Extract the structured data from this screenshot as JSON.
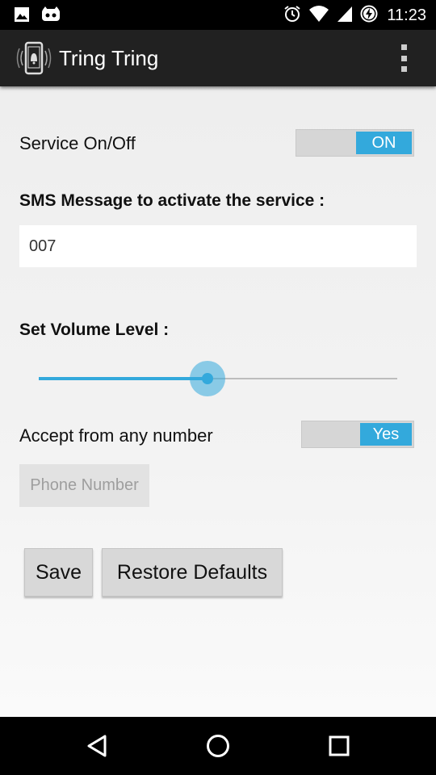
{
  "status_bar": {
    "time": "11:23",
    "left_icons": [
      "image-icon",
      "cyanogen-icon"
    ],
    "right_icons": [
      "alarm-icon",
      "wifi-icon",
      "signal-icon",
      "battery-charging-icon"
    ]
  },
  "action_bar": {
    "title": "Tring Tring",
    "app_icon": "phone-ringing-icon",
    "menu_icon": "overflow-menu-icon"
  },
  "settings": {
    "service_label": "Service On/Off",
    "service_toggle": "ON",
    "sms_label": "SMS Message to activate the service :",
    "sms_value": "007",
    "volume_label": "Set Volume Level :",
    "volume_level": 0.47,
    "accept_label": "Accept from any number",
    "accept_toggle": "Yes",
    "phone_placeholder": "Phone Number"
  },
  "buttons": {
    "save": "Save",
    "restore": "Restore Defaults"
  },
  "nav_bar": {
    "icons": [
      "back-icon",
      "home-icon",
      "recents-icon"
    ]
  },
  "colors": {
    "accent": "#33a9dc",
    "action_bar": "#212121",
    "background": "#eeeeee"
  }
}
